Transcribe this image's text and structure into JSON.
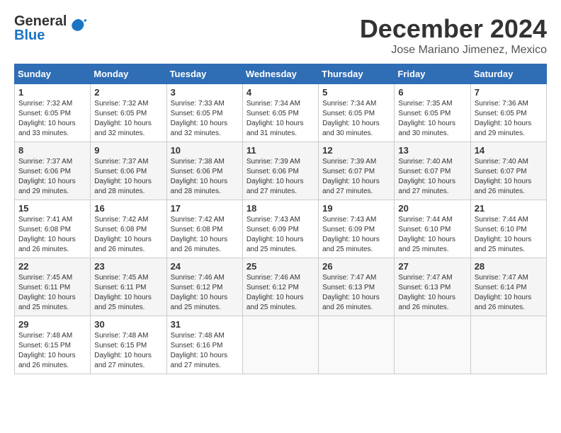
{
  "header": {
    "logo_general": "General",
    "logo_blue": "Blue",
    "month": "December 2024",
    "location": "Jose Mariano Jimenez, Mexico"
  },
  "days_of_week": [
    "Sunday",
    "Monday",
    "Tuesday",
    "Wednesday",
    "Thursday",
    "Friday",
    "Saturday"
  ],
  "weeks": [
    [
      {
        "day": "1",
        "sunrise": "7:32 AM",
        "sunset": "6:05 PM",
        "daylight": "10 hours and 33 minutes."
      },
      {
        "day": "2",
        "sunrise": "7:32 AM",
        "sunset": "6:05 PM",
        "daylight": "10 hours and 32 minutes."
      },
      {
        "day": "3",
        "sunrise": "7:33 AM",
        "sunset": "6:05 PM",
        "daylight": "10 hours and 32 minutes."
      },
      {
        "day": "4",
        "sunrise": "7:34 AM",
        "sunset": "6:05 PM",
        "daylight": "10 hours and 31 minutes."
      },
      {
        "day": "5",
        "sunrise": "7:34 AM",
        "sunset": "6:05 PM",
        "daylight": "10 hours and 30 minutes."
      },
      {
        "day": "6",
        "sunrise": "7:35 AM",
        "sunset": "6:05 PM",
        "daylight": "10 hours and 30 minutes."
      },
      {
        "day": "7",
        "sunrise": "7:36 AM",
        "sunset": "6:05 PM",
        "daylight": "10 hours and 29 minutes."
      }
    ],
    [
      {
        "day": "8",
        "sunrise": "7:37 AM",
        "sunset": "6:06 PM",
        "daylight": "10 hours and 29 minutes."
      },
      {
        "day": "9",
        "sunrise": "7:37 AM",
        "sunset": "6:06 PM",
        "daylight": "10 hours and 28 minutes."
      },
      {
        "day": "10",
        "sunrise": "7:38 AM",
        "sunset": "6:06 PM",
        "daylight": "10 hours and 28 minutes."
      },
      {
        "day": "11",
        "sunrise": "7:39 AM",
        "sunset": "6:06 PM",
        "daylight": "10 hours and 27 minutes."
      },
      {
        "day": "12",
        "sunrise": "7:39 AM",
        "sunset": "6:07 PM",
        "daylight": "10 hours and 27 minutes."
      },
      {
        "day": "13",
        "sunrise": "7:40 AM",
        "sunset": "6:07 PM",
        "daylight": "10 hours and 27 minutes."
      },
      {
        "day": "14",
        "sunrise": "7:40 AM",
        "sunset": "6:07 PM",
        "daylight": "10 hours and 26 minutes."
      }
    ],
    [
      {
        "day": "15",
        "sunrise": "7:41 AM",
        "sunset": "6:08 PM",
        "daylight": "10 hours and 26 minutes."
      },
      {
        "day": "16",
        "sunrise": "7:42 AM",
        "sunset": "6:08 PM",
        "daylight": "10 hours and 26 minutes."
      },
      {
        "day": "17",
        "sunrise": "7:42 AM",
        "sunset": "6:08 PM",
        "daylight": "10 hours and 26 minutes."
      },
      {
        "day": "18",
        "sunrise": "7:43 AM",
        "sunset": "6:09 PM",
        "daylight": "10 hours and 25 minutes."
      },
      {
        "day": "19",
        "sunrise": "7:43 AM",
        "sunset": "6:09 PM",
        "daylight": "10 hours and 25 minutes."
      },
      {
        "day": "20",
        "sunrise": "7:44 AM",
        "sunset": "6:10 PM",
        "daylight": "10 hours and 25 minutes."
      },
      {
        "day": "21",
        "sunrise": "7:44 AM",
        "sunset": "6:10 PM",
        "daylight": "10 hours and 25 minutes."
      }
    ],
    [
      {
        "day": "22",
        "sunrise": "7:45 AM",
        "sunset": "6:11 PM",
        "daylight": "10 hours and 25 minutes."
      },
      {
        "day": "23",
        "sunrise": "7:45 AM",
        "sunset": "6:11 PM",
        "daylight": "10 hours and 25 minutes."
      },
      {
        "day": "24",
        "sunrise": "7:46 AM",
        "sunset": "6:12 PM",
        "daylight": "10 hours and 25 minutes."
      },
      {
        "day": "25",
        "sunrise": "7:46 AM",
        "sunset": "6:12 PM",
        "daylight": "10 hours and 25 minutes."
      },
      {
        "day": "26",
        "sunrise": "7:47 AM",
        "sunset": "6:13 PM",
        "daylight": "10 hours and 26 minutes."
      },
      {
        "day": "27",
        "sunrise": "7:47 AM",
        "sunset": "6:13 PM",
        "daylight": "10 hours and 26 minutes."
      },
      {
        "day": "28",
        "sunrise": "7:47 AM",
        "sunset": "6:14 PM",
        "daylight": "10 hours and 26 minutes."
      }
    ],
    [
      {
        "day": "29",
        "sunrise": "7:48 AM",
        "sunset": "6:15 PM",
        "daylight": "10 hours and 26 minutes."
      },
      {
        "day": "30",
        "sunrise": "7:48 AM",
        "sunset": "6:15 PM",
        "daylight": "10 hours and 27 minutes."
      },
      {
        "day": "31",
        "sunrise": "7:48 AM",
        "sunset": "6:16 PM",
        "daylight": "10 hours and 27 minutes."
      },
      null,
      null,
      null,
      null
    ]
  ]
}
